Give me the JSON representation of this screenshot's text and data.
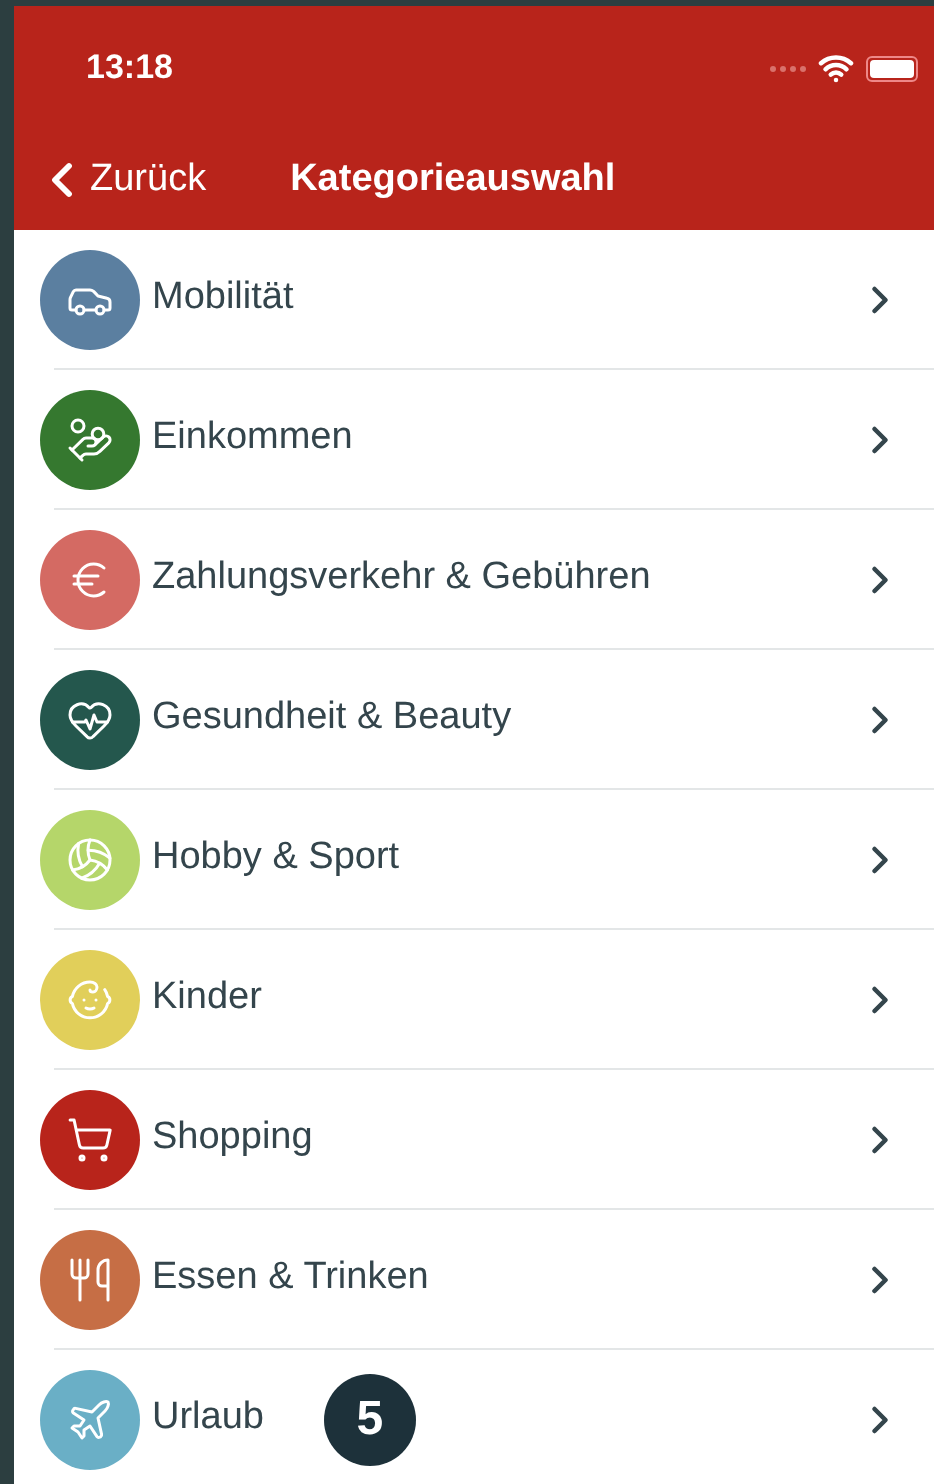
{
  "status_bar": {
    "time": "13:18"
  },
  "nav": {
    "back": "Zurück",
    "title": "Kategorieauswahl"
  },
  "categories": [
    {
      "label": "Mobilität",
      "color": "#5b7fa0"
    },
    {
      "label": "Einkommen",
      "color": "#35782f"
    },
    {
      "label": "Zahlungsverkehr & Gebühren",
      "color": "#d46a63"
    },
    {
      "label": "Gesundheit & Beauty",
      "color": "#24574d"
    },
    {
      "label": "Hobby & Sport",
      "color": "#b5d66a"
    },
    {
      "label": "Kinder",
      "color": "#e1cf5a"
    },
    {
      "label": "Shopping",
      "color": "#b8241b"
    },
    {
      "label": "Essen & Trinken",
      "color": "#c66e45"
    },
    {
      "label": "Urlaub",
      "color": "#6aafc6",
      "badge": "5"
    }
  ]
}
